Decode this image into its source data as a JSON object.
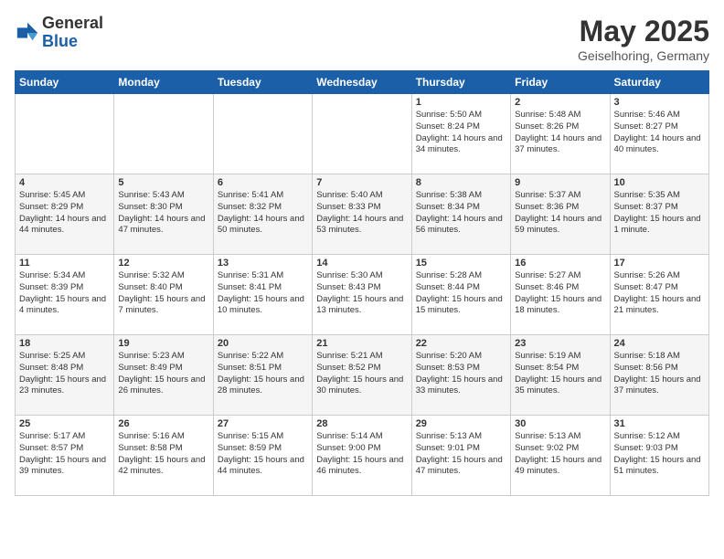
{
  "header": {
    "logo_line1": "General",
    "logo_line2": "Blue",
    "month": "May 2025",
    "location": "Geiselhoring, Germany"
  },
  "weekdays": [
    "Sunday",
    "Monday",
    "Tuesday",
    "Wednesday",
    "Thursday",
    "Friday",
    "Saturday"
  ],
  "weeks": [
    [
      {
        "day": "",
        "sunrise": "",
        "sunset": "",
        "daylight": ""
      },
      {
        "day": "",
        "sunrise": "",
        "sunset": "",
        "daylight": ""
      },
      {
        "day": "",
        "sunrise": "",
        "sunset": "",
        "daylight": ""
      },
      {
        "day": "",
        "sunrise": "",
        "sunset": "",
        "daylight": ""
      },
      {
        "day": "1",
        "sunrise": "Sunrise: 5:50 AM",
        "sunset": "Sunset: 8:24 PM",
        "daylight": "Daylight: 14 hours and 34 minutes."
      },
      {
        "day": "2",
        "sunrise": "Sunrise: 5:48 AM",
        "sunset": "Sunset: 8:26 PM",
        "daylight": "Daylight: 14 hours and 37 minutes."
      },
      {
        "day": "3",
        "sunrise": "Sunrise: 5:46 AM",
        "sunset": "Sunset: 8:27 PM",
        "daylight": "Daylight: 14 hours and 40 minutes."
      }
    ],
    [
      {
        "day": "4",
        "sunrise": "Sunrise: 5:45 AM",
        "sunset": "Sunset: 8:29 PM",
        "daylight": "Daylight: 14 hours and 44 minutes."
      },
      {
        "day": "5",
        "sunrise": "Sunrise: 5:43 AM",
        "sunset": "Sunset: 8:30 PM",
        "daylight": "Daylight: 14 hours and 47 minutes."
      },
      {
        "day": "6",
        "sunrise": "Sunrise: 5:41 AM",
        "sunset": "Sunset: 8:32 PM",
        "daylight": "Daylight: 14 hours and 50 minutes."
      },
      {
        "day": "7",
        "sunrise": "Sunrise: 5:40 AM",
        "sunset": "Sunset: 8:33 PM",
        "daylight": "Daylight: 14 hours and 53 minutes."
      },
      {
        "day": "8",
        "sunrise": "Sunrise: 5:38 AM",
        "sunset": "Sunset: 8:34 PM",
        "daylight": "Daylight: 14 hours and 56 minutes."
      },
      {
        "day": "9",
        "sunrise": "Sunrise: 5:37 AM",
        "sunset": "Sunset: 8:36 PM",
        "daylight": "Daylight: 14 hours and 59 minutes."
      },
      {
        "day": "10",
        "sunrise": "Sunrise: 5:35 AM",
        "sunset": "Sunset: 8:37 PM",
        "daylight": "Daylight: 15 hours and 1 minute."
      }
    ],
    [
      {
        "day": "11",
        "sunrise": "Sunrise: 5:34 AM",
        "sunset": "Sunset: 8:39 PM",
        "daylight": "Daylight: 15 hours and 4 minutes."
      },
      {
        "day": "12",
        "sunrise": "Sunrise: 5:32 AM",
        "sunset": "Sunset: 8:40 PM",
        "daylight": "Daylight: 15 hours and 7 minutes."
      },
      {
        "day": "13",
        "sunrise": "Sunrise: 5:31 AM",
        "sunset": "Sunset: 8:41 PM",
        "daylight": "Daylight: 15 hours and 10 minutes."
      },
      {
        "day": "14",
        "sunrise": "Sunrise: 5:30 AM",
        "sunset": "Sunset: 8:43 PM",
        "daylight": "Daylight: 15 hours and 13 minutes."
      },
      {
        "day": "15",
        "sunrise": "Sunrise: 5:28 AM",
        "sunset": "Sunset: 8:44 PM",
        "daylight": "Daylight: 15 hours and 15 minutes."
      },
      {
        "day": "16",
        "sunrise": "Sunrise: 5:27 AM",
        "sunset": "Sunset: 8:46 PM",
        "daylight": "Daylight: 15 hours and 18 minutes."
      },
      {
        "day": "17",
        "sunrise": "Sunrise: 5:26 AM",
        "sunset": "Sunset: 8:47 PM",
        "daylight": "Daylight: 15 hours and 21 minutes."
      }
    ],
    [
      {
        "day": "18",
        "sunrise": "Sunrise: 5:25 AM",
        "sunset": "Sunset: 8:48 PM",
        "daylight": "Daylight: 15 hours and 23 minutes."
      },
      {
        "day": "19",
        "sunrise": "Sunrise: 5:23 AM",
        "sunset": "Sunset: 8:49 PM",
        "daylight": "Daylight: 15 hours and 26 minutes."
      },
      {
        "day": "20",
        "sunrise": "Sunrise: 5:22 AM",
        "sunset": "Sunset: 8:51 PM",
        "daylight": "Daylight: 15 hours and 28 minutes."
      },
      {
        "day": "21",
        "sunrise": "Sunrise: 5:21 AM",
        "sunset": "Sunset: 8:52 PM",
        "daylight": "Daylight: 15 hours and 30 minutes."
      },
      {
        "day": "22",
        "sunrise": "Sunrise: 5:20 AM",
        "sunset": "Sunset: 8:53 PM",
        "daylight": "Daylight: 15 hours and 33 minutes."
      },
      {
        "day": "23",
        "sunrise": "Sunrise: 5:19 AM",
        "sunset": "Sunset: 8:54 PM",
        "daylight": "Daylight: 15 hours and 35 minutes."
      },
      {
        "day": "24",
        "sunrise": "Sunrise: 5:18 AM",
        "sunset": "Sunset: 8:56 PM",
        "daylight": "Daylight: 15 hours and 37 minutes."
      }
    ],
    [
      {
        "day": "25",
        "sunrise": "Sunrise: 5:17 AM",
        "sunset": "Sunset: 8:57 PM",
        "daylight": "Daylight: 15 hours and 39 minutes."
      },
      {
        "day": "26",
        "sunrise": "Sunrise: 5:16 AM",
        "sunset": "Sunset: 8:58 PM",
        "daylight": "Daylight: 15 hours and 42 minutes."
      },
      {
        "day": "27",
        "sunrise": "Sunrise: 5:15 AM",
        "sunset": "Sunset: 8:59 PM",
        "daylight": "Daylight: 15 hours and 44 minutes."
      },
      {
        "day": "28",
        "sunrise": "Sunrise: 5:14 AM",
        "sunset": "Sunset: 9:00 PM",
        "daylight": "Daylight: 15 hours and 46 minutes."
      },
      {
        "day": "29",
        "sunrise": "Sunrise: 5:13 AM",
        "sunset": "Sunset: 9:01 PM",
        "daylight": "Daylight: 15 hours and 47 minutes."
      },
      {
        "day": "30",
        "sunrise": "Sunrise: 5:13 AM",
        "sunset": "Sunset: 9:02 PM",
        "daylight": "Daylight: 15 hours and 49 minutes."
      },
      {
        "day": "31",
        "sunrise": "Sunrise: 5:12 AM",
        "sunset": "Sunset: 9:03 PM",
        "daylight": "Daylight: 15 hours and 51 minutes."
      }
    ]
  ]
}
